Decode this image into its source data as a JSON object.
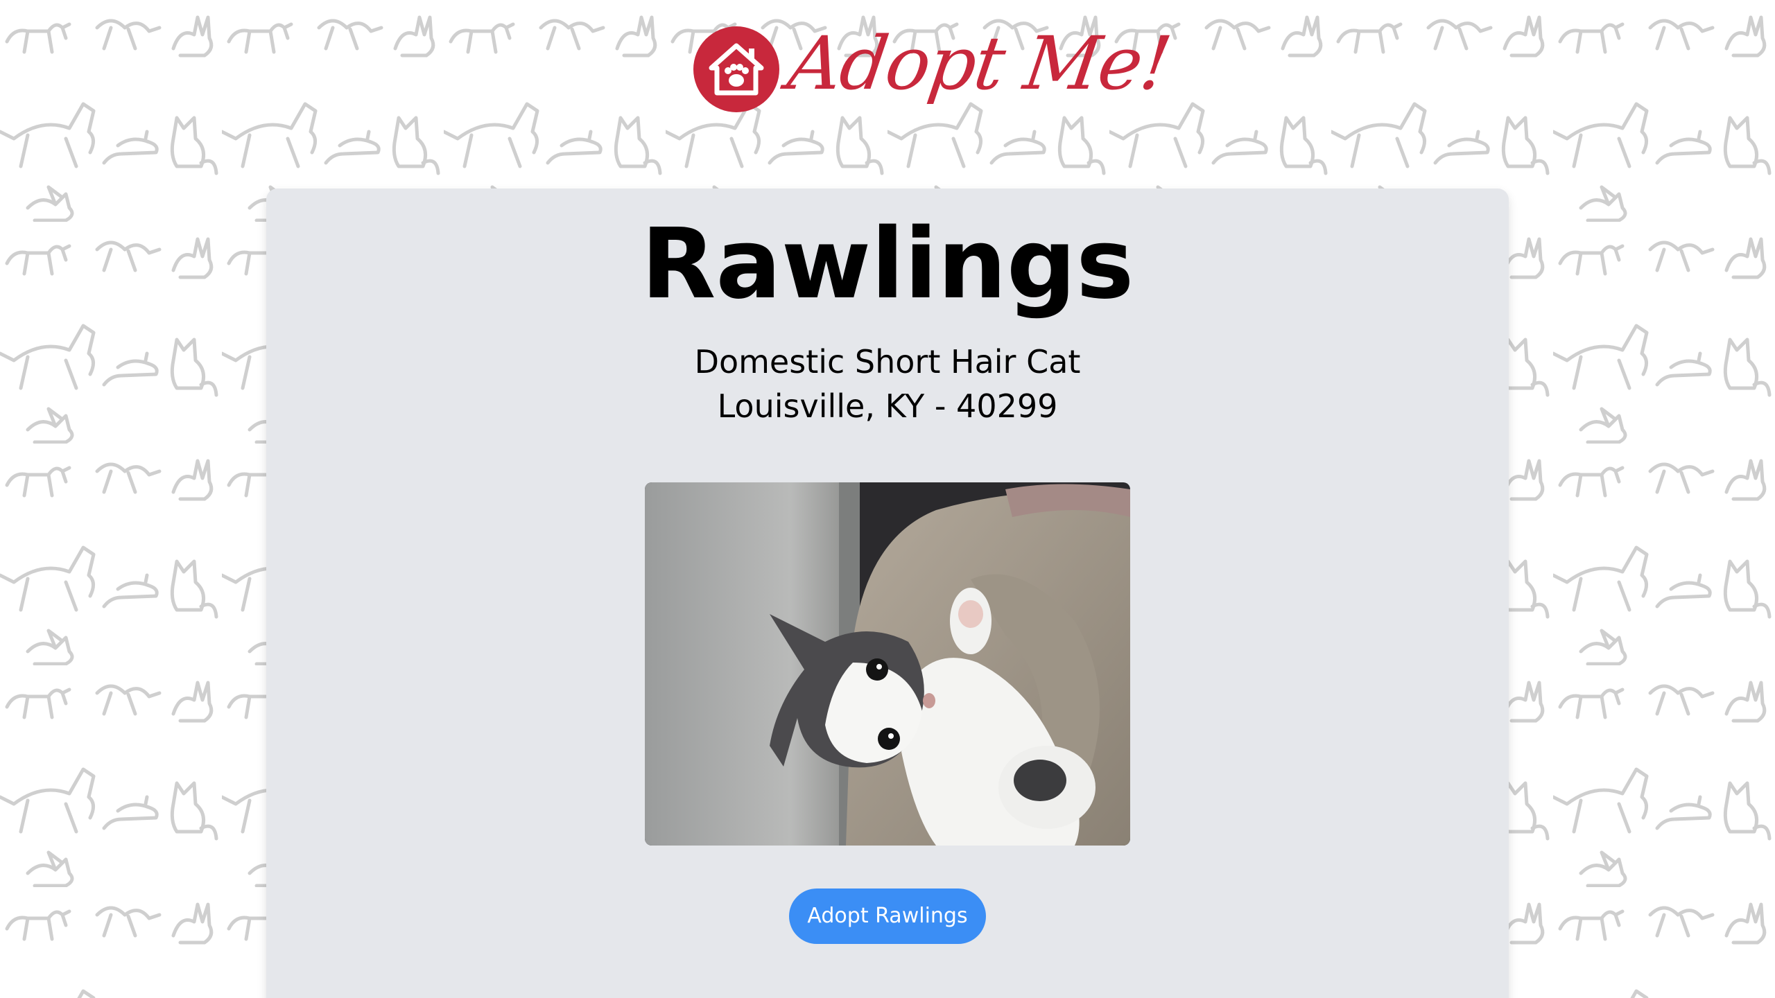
{
  "header": {
    "logo_text": "Adopt Me!",
    "logo_icon": "house-paw-icon",
    "brand_color": "#c8283c"
  },
  "background": {
    "pattern": "animal-doodles",
    "pattern_color": "#cfcfcf"
  },
  "pet": {
    "name": "Rawlings",
    "breed_line": "Domestic Short Hair Cat",
    "location_line": "Louisville, KY - 40299",
    "photo": "kitten-photo"
  },
  "actions": {
    "adopt_label": "Adopt Rawlings",
    "button_color": "#3b8ef5"
  },
  "card": {
    "background_color": "#e5e7eb"
  }
}
